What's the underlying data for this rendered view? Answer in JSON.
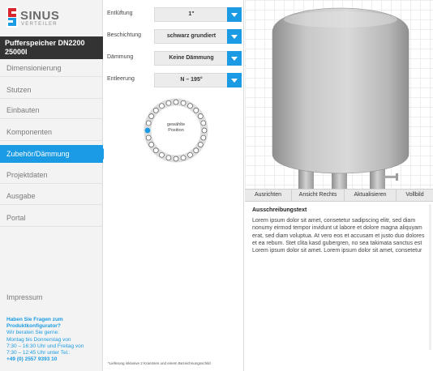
{
  "sidebar": {
    "logo": {
      "word": "SINUS",
      "sub": "VERTEILER"
    },
    "product_title": "Pufferspeicher DN2200 25000l",
    "nav": [
      {
        "label": "Dimensionierung"
      },
      {
        "label": "Stutzen"
      },
      {
        "label": "Einbauten"
      },
      {
        "label": "Komponenten"
      },
      {
        "label": "Zubehör/Dämmung",
        "active": true
      },
      {
        "label": "Projektdaten"
      },
      {
        "label": "Ausgabe"
      },
      {
        "label": "Portal"
      }
    ],
    "impressum": "Impressum",
    "help": {
      "question": "Haben Sie Fragen zum Produktkonfigurator?",
      "line1": "Wir beraten Sie gerne:",
      "line2": "Montag bis Donnerstag von",
      "line3": "7:30 – 16:30 Uhr und Freitag von",
      "line4": "7:30 – 12:45 Uhr unter Tel.:",
      "phone": "+49 (0) 2557 9393 10"
    }
  },
  "options": [
    {
      "label": "Entlüftung",
      "value": "1\""
    },
    {
      "label": "Beschichtung",
      "value": "schwarz grundiert"
    },
    {
      "label": "Dämmung",
      "value": "Keine Dämmung"
    },
    {
      "label": "Entleerung",
      "value": "N – 195°"
    }
  ],
  "position_selector": {
    "center_label": "gewählte Position",
    "count": 24,
    "selected_index": 18
  },
  "footnote": "*Lieferung inklusive 2 Kranösen und einem Bezeichnungsschild",
  "toolbar": {
    "buttons": [
      "Ausrichten",
      "Ansicht Rechts",
      "Aktualisieren",
      "Vollbild"
    ]
  },
  "spec": {
    "title": "Ausschreibungstext",
    "text": "Lorem ipsum dolor sit amet, consetetur sadipscing elitr, sed diam nonumy eirmod tempor invidunt ut labore et dolore magna aliquyam erat, sed diam voluptua. At vero eos et accusam et justo duo dolores et ea rebum. Stet clita kasd gubergren, no sea takimata sanctus est Lorem ipsum dolor sit amet. Lorem ipsum dolor sit amet, consetetur"
  },
  "colors": {
    "accent": "#1a9be3",
    "title_bar": "#333333",
    "sidebar_bg": "#f3f3f3",
    "logo_red": "#d7262d"
  },
  "icons": {
    "logo": "sinus-logo-icon",
    "dropdown": "chevron-down-icon",
    "tank": "tank-icon"
  }
}
